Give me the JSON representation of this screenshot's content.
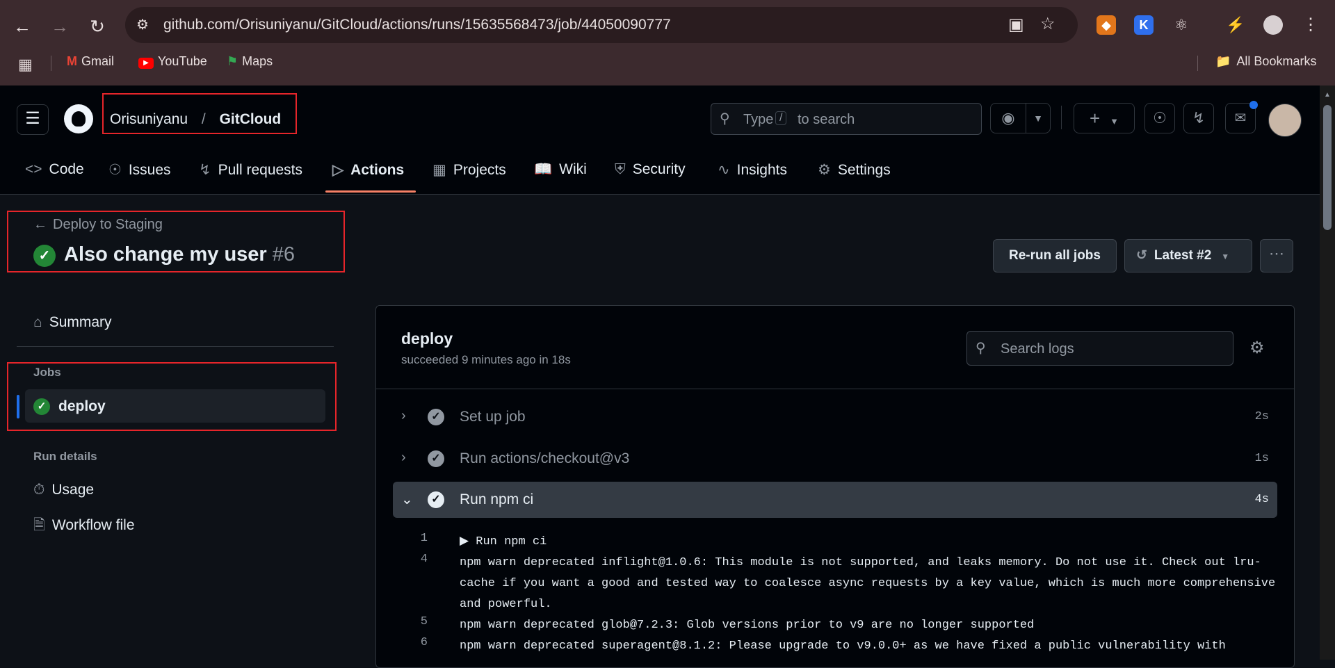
{
  "browser": {
    "url": "github.com/Orisuniyanu/GitCloud/actions/runs/15635568473/job/44050090777",
    "bookmarks": [
      {
        "label": "Gmail",
        "icon": "gmail-icon"
      },
      {
        "label": "YouTube",
        "icon": "youtube-icon"
      },
      {
        "label": "Maps",
        "icon": "maps-icon"
      }
    ],
    "all_bookmarks_label": "All Bookmarks"
  },
  "header": {
    "owner": "Orisuniyanu",
    "separator": "/",
    "repo": "GitCloud",
    "search_prefix": "Type",
    "search_key": "/",
    "search_suffix": "to search"
  },
  "tabs": [
    {
      "label": "Code",
      "icon": "code-icon"
    },
    {
      "label": "Issues",
      "icon": "issue-icon"
    },
    {
      "label": "Pull requests",
      "icon": "pull-request-icon"
    },
    {
      "label": "Actions",
      "icon": "play-icon",
      "active": true
    },
    {
      "label": "Projects",
      "icon": "table-icon"
    },
    {
      "label": "Wiki",
      "icon": "book-icon"
    },
    {
      "label": "Security",
      "icon": "shield-icon"
    },
    {
      "label": "Insights",
      "icon": "graph-icon"
    },
    {
      "label": "Settings",
      "icon": "gear-icon"
    }
  ],
  "run": {
    "back_label": "Deploy to Staging",
    "title": "Also change my user",
    "number": "#6",
    "rerun_label": "Re-run all jobs",
    "attempt_label": "Latest #2"
  },
  "sidebar": {
    "summary": "Summary",
    "jobs_heading": "Jobs",
    "job": "deploy",
    "run_details_heading": "Run details",
    "usage": "Usage",
    "workflow_file": "Workflow file"
  },
  "job": {
    "name": "deploy",
    "status": "succeeded 9 minutes ago in 18s",
    "search_placeholder": "Search logs",
    "steps": [
      {
        "label": "Set up job",
        "duration": "2s",
        "expanded": false
      },
      {
        "label": "Run actions/checkout@v3",
        "duration": "1s",
        "expanded": false
      },
      {
        "label": "Run npm ci",
        "duration": "4s",
        "expanded": true
      }
    ],
    "log": [
      {
        "num": "1",
        "text": "▶ Run npm ci"
      },
      {
        "num": "4",
        "text": "npm warn deprecated inflight@1.0.6: This module is not supported, and leaks memory. Do not use it. Check out lru-cache if you want a good and tested way to coalesce async requests by a key value, which is much more comprehensive and powerful."
      },
      {
        "num": "5",
        "text": "npm warn deprecated glob@7.2.3: Glob versions prior to v9 are no longer supported"
      },
      {
        "num": "6",
        "text": "npm warn deprecated superagent@8.1.2: Please upgrade to v9.0.0+ as we have fixed a public vulnerability with"
      }
    ]
  },
  "colors": {
    "accent": "#f78166",
    "success": "#238636",
    "annotation": "#e5252a"
  }
}
